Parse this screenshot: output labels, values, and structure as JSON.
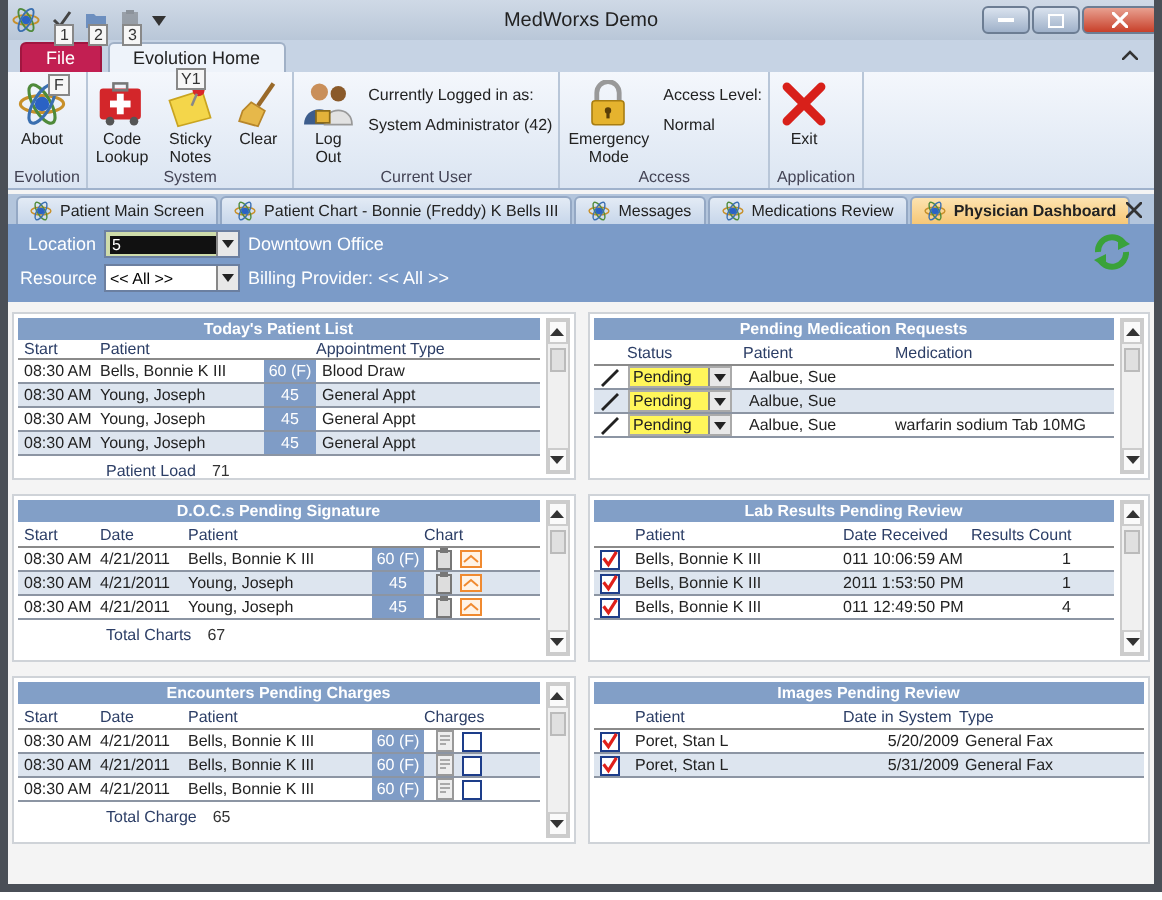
{
  "window": {
    "title": "MedWorxs Demo"
  },
  "quick_access": [
    {
      "keytip": "1",
      "disabled": false
    },
    {
      "keytip": "2",
      "disabled": false
    },
    {
      "keytip": "3",
      "disabled": true
    }
  ],
  "ribbon_tabs": [
    {
      "label": "File",
      "keytip": "F",
      "kind": "file",
      "selected": false
    },
    {
      "label": "Evolution Home",
      "keytip": "Y1",
      "kind": "tab",
      "selected": true
    }
  ],
  "ribbon_groups": [
    {
      "name": "Evolution",
      "items": [
        {
          "kind": "button",
          "label": "About"
        }
      ]
    },
    {
      "name": "System",
      "items": [
        {
          "kind": "button",
          "label": "Code Lookup"
        },
        {
          "kind": "button",
          "label": "Sticky Notes"
        },
        {
          "kind": "button",
          "label": "Clear"
        }
      ]
    },
    {
      "name": "Current User",
      "items": [
        {
          "kind": "button",
          "label": "Log Out"
        },
        {
          "kind": "info",
          "heading": "Currently Logged in as:",
          "value": "System Administrator (42)"
        }
      ]
    },
    {
      "name": "Access",
      "items": [
        {
          "kind": "button",
          "label": "Emergency Mode"
        },
        {
          "kind": "info",
          "heading": "Access Level:",
          "value": "Normal"
        }
      ]
    },
    {
      "name": "Application",
      "items": [
        {
          "kind": "button",
          "label": "Exit"
        }
      ]
    }
  ],
  "document_tabs": [
    {
      "label": "Patient Main Screen",
      "selected": false
    },
    {
      "label": "Patient Chart - Bonnie (Freddy) K Bells III",
      "selected": false
    },
    {
      "label": "Messages",
      "selected": false
    },
    {
      "label": "Medications Review",
      "selected": false
    },
    {
      "label": "Physician Dashboard",
      "selected": true
    }
  ],
  "filters": {
    "location": {
      "label": "Location",
      "value": "5",
      "office": "Downtown Office"
    },
    "resource": {
      "label": "Resource",
      "value": "<< All >>",
      "billing": "Billing Provider: << All >>"
    }
  },
  "panels_left": [
    {
      "kind": "appointments",
      "title": "Today's Patient List",
      "columns": [
        "Start",
        "Patient",
        "Appointment Type"
      ],
      "rows": [
        {
          "start": "08:30 AM",
          "patient": "Bells, Bonnie K III",
          "duration": "60 (F)",
          "type": "Blood Draw"
        },
        {
          "start": "08:30 AM",
          "patient": "Young, Joseph",
          "duration": "45",
          "type": "General Appt"
        },
        {
          "start": "08:30 AM",
          "patient": "Young, Joseph",
          "duration": "45",
          "type": "General Appt"
        },
        {
          "start": "08:30 AM",
          "patient": "Young, Joseph",
          "duration": "45",
          "type": "General Appt"
        }
      ],
      "footer": {
        "label": "Patient Load",
        "value": "71"
      }
    },
    {
      "kind": "documents",
      "title": "D.O.C.s Pending Signature",
      "columns": [
        "Start",
        "Date",
        "Patient",
        "Chart"
      ],
      "rows": [
        {
          "start": "08:30 AM",
          "date": "4/21/2011",
          "patient": "Bells, Bonnie K III",
          "duration": "60 (F)"
        },
        {
          "start": "08:30 AM",
          "date": "4/21/2011",
          "patient": "Young, Joseph",
          "duration": "45"
        },
        {
          "start": "08:30 AM",
          "date": "4/21/2011",
          "patient": "Young, Joseph",
          "duration": "45"
        }
      ],
      "footer": {
        "label": "Total Charts",
        "value": "67"
      }
    },
    {
      "kind": "charges",
      "title": "Encounters Pending Charges",
      "columns": [
        "Start",
        "Date",
        "Patient",
        "Charges"
      ],
      "rows": [
        {
          "start": "08:30 AM",
          "date": "4/21/2011",
          "patient": "Bells, Bonnie K III",
          "duration": "60 (F)",
          "checked": false
        },
        {
          "start": "08:30 AM",
          "date": "4/21/2011",
          "patient": "Bells, Bonnie K III",
          "duration": "60 (F)",
          "checked": false
        },
        {
          "start": "08:30 AM",
          "date": "4/21/2011",
          "patient": "Bells, Bonnie K III",
          "duration": "60 (F)",
          "checked": false
        }
      ],
      "footer": {
        "label": "Total Charge",
        "value": "65"
      }
    }
  ],
  "panels_right": [
    {
      "kind": "medications",
      "title": "Pending Medication Requests",
      "columns": [
        "Status",
        "Patient",
        "Medication"
      ],
      "rows": [
        {
          "status": "Pending",
          "patient": "Aalbue, Sue"
        },
        {
          "status": "Pending",
          "patient": "Aalbue, Sue"
        },
        {
          "status": "Pending",
          "patient": "Aalbue, Sue",
          "medication": "warfarin sodium Tab 10MG"
        }
      ]
    },
    {
      "kind": "labs",
      "title": "Lab Results Pending Review",
      "columns": [
        "Patient",
        "Date Received",
        "Results Count"
      ],
      "rows": [
        {
          "checked": true,
          "patient": "Bells, Bonnie K III",
          "date": "011 10:06:59 AM",
          "count": "1"
        },
        {
          "checked": true,
          "patient": "Bells, Bonnie K III",
          "date": "2011 1:53:50 PM",
          "count": "1"
        },
        {
          "checked": true,
          "patient": "Bells, Bonnie K III",
          "date": "011 12:49:50 PM",
          "count": "4"
        }
      ]
    },
    {
      "kind": "images",
      "title": "Images Pending Review",
      "columns": [
        "Patient",
        "Date in System",
        "Type"
      ],
      "rows": [
        {
          "checked": true,
          "patient": "Poret, Stan L",
          "date": "5/20/2009",
          "type": "General Fax"
        },
        {
          "checked": true,
          "patient": "Poret, Stan L",
          "date": "5/31/2009",
          "type": "General Fax"
        }
      ]
    }
  ]
}
